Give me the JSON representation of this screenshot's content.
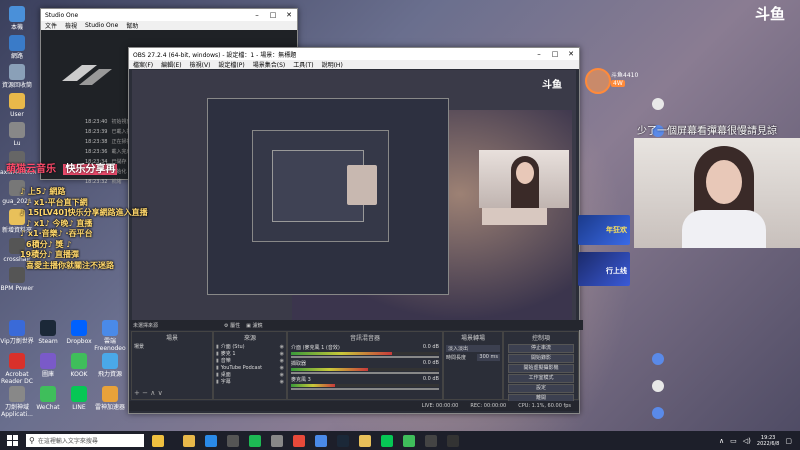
{
  "desktop_icons": [
    {
      "label": "本機",
      "color": "#4a90d9"
    },
    {
      "label": "網路",
      "color": "#3a7bc8"
    },
    {
      "label": "資源回收筒",
      "color": "#8aa0b8"
    },
    {
      "label": "User",
      "color": "#e8b84a"
    },
    {
      "label": "Lu",
      "color": "#888"
    },
    {
      "label": "axial4ection",
      "color": "#666"
    },
    {
      "label": "gua_2021",
      "color": "#777"
    },
    {
      "label": "新增資料夾",
      "color": "#e8c05a"
    },
    {
      "label": "crosshair",
      "color": "#555"
    },
    {
      "label": "BPM Power",
      "color": "#555"
    }
  ],
  "desktop_icons_row1": [
    {
      "label": "Vip刀劍世界",
      "color": "#3a6ad8"
    },
    {
      "label": "Steam",
      "color": "#1b2838"
    },
    {
      "label": "Dropbox",
      "color": "#0061fe"
    },
    {
      "label": "雲端 Freenodeo",
      "color": "#4a8ae8"
    }
  ],
  "desktop_icons_row2": [
    {
      "label": "Acrobat Reader DC",
      "color": "#d9312b"
    },
    {
      "label": "圖庫",
      "color": "#7a5ac8"
    },
    {
      "label": "KOOK",
      "color": "#3fbe5b"
    },
    {
      "label": "飛力資源",
      "color": "#4aa8e8"
    }
  ],
  "desktop_icons_row3": [
    {
      "label": "刀劍神域 Applicati...",
      "color": "#888"
    },
    {
      "label": "WeChat",
      "color": "#3fbe5b"
    },
    {
      "label": "LINE",
      "color": "#06c755"
    },
    {
      "label": "雷神加速器",
      "color": "#e8a23a"
    }
  ],
  "studio_one": {
    "title": "Studio One",
    "menu": [
      "文件",
      "檢視",
      "Studio One",
      "幫助"
    ],
    "log_times": [
      "18:23:40",
      "18:23:39",
      "18:23:38",
      "18:23:36",
      "18:23:34",
      "18:23:33",
      "18:23:32"
    ],
    "log_lines": [
      "初始視窗",
      "已載入插件",
      "正在掃描",
      "載入完成",
      "已儲存",
      "初始化",
      "就緒"
    ]
  },
  "obs": {
    "title": "OBS 27.2.4 (64-bit, windows) - 設定檔：1 - 場景：無標題",
    "menu": [
      "檔案(F)",
      "編輯(E)",
      "檢視(V)",
      "設定檔(P)",
      "場景集合(S)",
      "工具(T)",
      "說明(H)"
    ],
    "source_bar": "未選擇來源",
    "btn_properties": "屬性",
    "btn_filters": "濾鏡",
    "scenes_title": "場景",
    "scene_item": "場景",
    "sources_title": "來源",
    "sources": [
      "介面 (Stu)",
      "麥克 1",
      "音樂",
      "YouTube Podcast",
      "桌面",
      "字幕"
    ],
    "mixer_title": "音訊混音器",
    "mixer_tracks": [
      {
        "name": "介面 (麥克風 1 (音效)",
        "db": "0.0 dB",
        "level": 0.68
      },
      {
        "name": "擷取器",
        "db": "0.0 dB",
        "level": 0.52
      },
      {
        "name": "麥克風 3",
        "db": "0.0 dB",
        "level": 0.3
      }
    ],
    "transitions_title": "場景轉場",
    "transition_value": "淡入淡出",
    "duration_label": "時間長度",
    "duration_value": "300 ms",
    "controls_title": "控制項",
    "controls": [
      "停止串流",
      "開始錄影",
      "開始虛擬攝影機",
      "工作室模式",
      "設定",
      "離開"
    ],
    "status_live": "LIVE: 00:00:00",
    "status_rec": "REC: 00:00:00",
    "status_cpu": "CPU: 1.1%, 60.00 fps"
  },
  "overlay": {
    "brand_logo": "斗鱼",
    "streamer_name": "斗鱼4410",
    "streamer_level": "4W",
    "chat_logo_lines": [
      "萌猫云音乐",
      "快乐分享再"
    ],
    "chat_lines": [
      "♪ 上5♪ 網路",
      "♪ x1·平台直下網",
      "♪ 15[LV40]快乐分享網路進入直播",
      "♪ x1♪ 今晚♪ 直播",
      "♪ x1·音樂♪ ·吞平台",
      "6積分♪ 獎 ♪",
      "19積分♪ 直播彈",
      "喜愛主播你就關注不迷路"
    ],
    "subtitle": "少了一個屏幕看彈幕很慢請見諒",
    "banner_text": "年狂欢",
    "banner_text2": "行上线"
  },
  "taskbar": {
    "search_placeholder": "在這裡輸入文字來搜尋",
    "time": "19:23",
    "date": "2022/6/8",
    "apps": [
      {
        "name": "folder",
        "color": "#e8b84a"
      },
      {
        "name": "edge",
        "color": "#2a8ae8"
      },
      {
        "name": "store",
        "color": "#555"
      },
      {
        "name": "spotify",
        "color": "#1db954"
      },
      {
        "name": "obs",
        "color": "#888"
      },
      {
        "name": "chrome",
        "color": "#e84a3a"
      },
      {
        "name": "mail",
        "color": "#4a8ae8"
      },
      {
        "name": "steam",
        "color": "#1b2838"
      },
      {
        "name": "explorer",
        "color": "#e8c05a"
      },
      {
        "name": "line",
        "color": "#06c755"
      },
      {
        "name": "green",
        "color": "#3fbe5b"
      },
      {
        "name": "obs2",
        "color": "#444"
      },
      {
        "name": "circle",
        "color": "#333"
      }
    ]
  }
}
